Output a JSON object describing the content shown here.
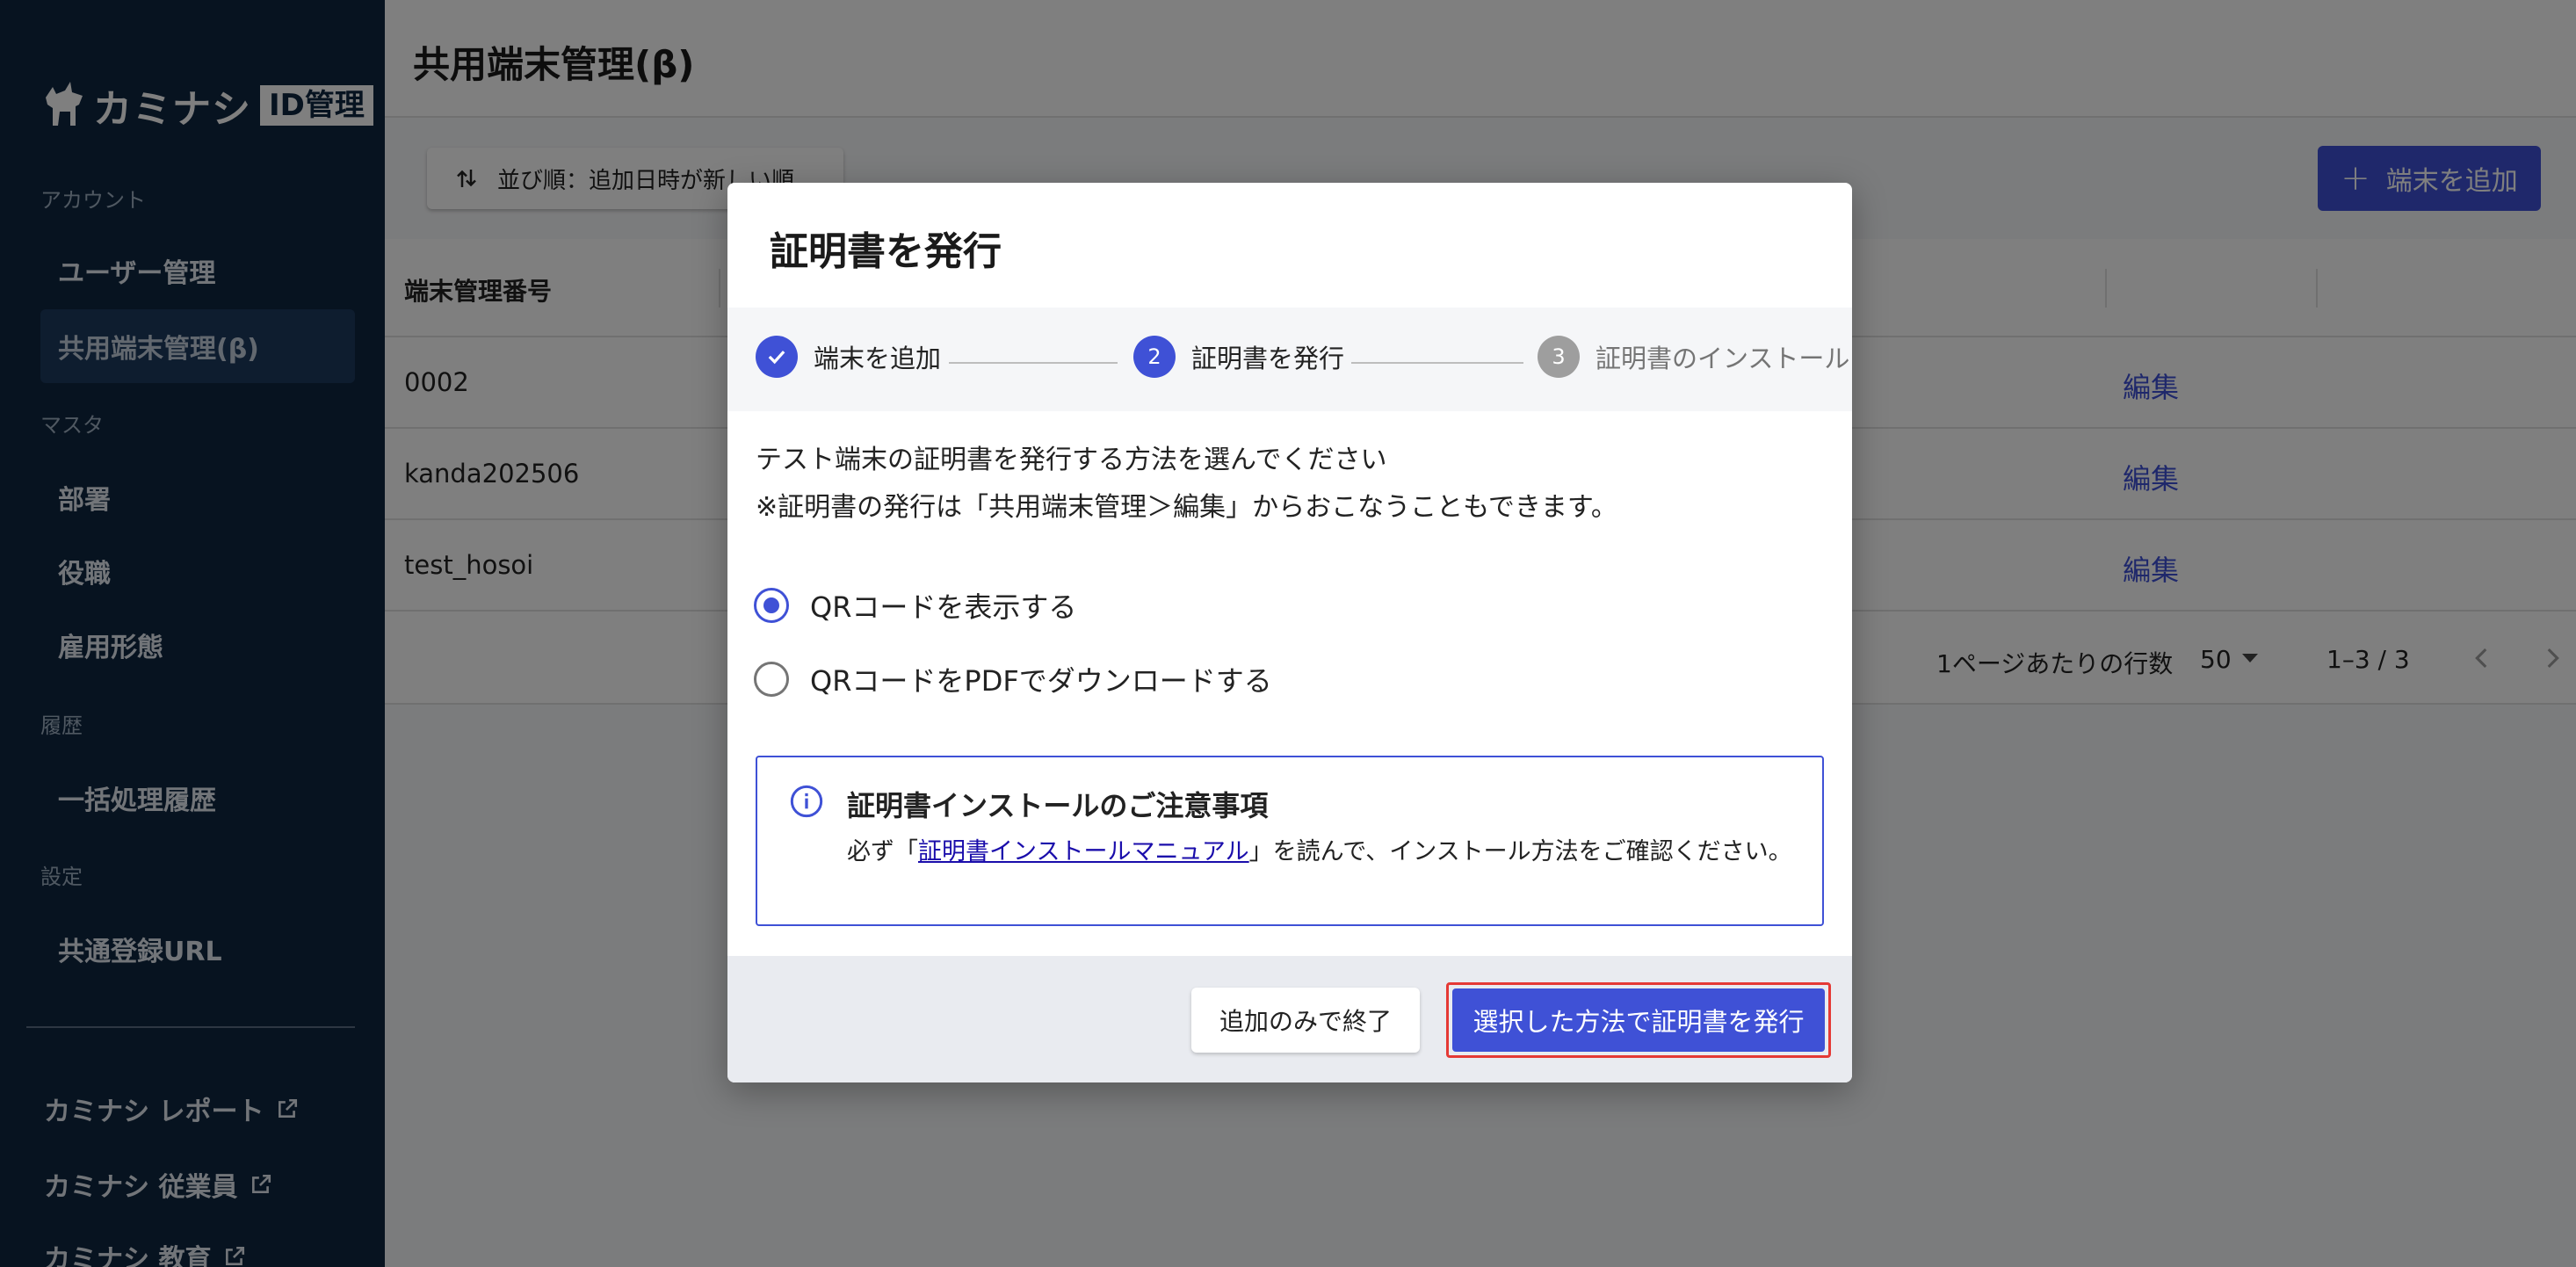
{
  "app": {
    "logo_text": "カミナシ",
    "logo_badge": "ID管理"
  },
  "sidebar": {
    "sections": [
      {
        "label": "アカウント"
      },
      {
        "label": "マスタ"
      },
      {
        "label": "履歴"
      },
      {
        "label": "設定"
      }
    ],
    "items": [
      {
        "label": "ユーザー管理"
      },
      {
        "label": "共用端末管理(β)"
      },
      {
        "label": "部署"
      },
      {
        "label": "役職"
      },
      {
        "label": "雇用形態"
      },
      {
        "label": "一括処理履歴"
      },
      {
        "label": "共通登録URL"
      }
    ],
    "external_links": [
      {
        "label": "カミナシ レポート"
      },
      {
        "label": "カミナシ 従業員"
      },
      {
        "label": "カミナシ 教育"
      }
    ]
  },
  "header": {
    "title": "共用端末管理(β)"
  },
  "toolbar": {
    "sort_label": "並び順：追加日時が新しい順",
    "add_label": "端末を追加"
  },
  "table": {
    "columns": [
      "端末管理番号"
    ],
    "rows": [
      {
        "id": "0002",
        "action": "編集"
      },
      {
        "id": "kanda202506",
        "action": "編集"
      },
      {
        "id": "test_hosoi",
        "action": "編集"
      }
    ]
  },
  "pagination": {
    "rows_per_page_label": "1ページあたりの行数",
    "rows_per_page": "50",
    "range": "1–3 / 3"
  },
  "modal": {
    "title": "証明書を発行",
    "steps": [
      {
        "number": "1",
        "label": "端末を追加",
        "state": "done"
      },
      {
        "number": "2",
        "label": "証明書を発行",
        "state": "current"
      },
      {
        "number": "3",
        "label": "証明書のインストール",
        "state": "todo"
      }
    ],
    "description_line1": "テスト端末の証明書を発行する方法を選んでください",
    "description_line2": "※証明書の発行は「共用端末管理＞編集」からおこなうこともできます。",
    "options": [
      {
        "label": "QRコードを表示する",
        "checked": true
      },
      {
        "label": "QRコードをPDFでダウンロードする",
        "checked": false
      }
    ],
    "notice": {
      "title": "証明書インストールのご注意事項",
      "body_before": "必ず「",
      "link": "証明書インストールマニュアル",
      "body_after": "」を読んで、インストール方法をご確認ください。"
    },
    "footer": {
      "secondary_label": "追加のみで終了",
      "primary_label": "選択した方法で証明書を発行"
    }
  },
  "colors": {
    "sidebar_bg": "#0f2640",
    "accent": "#3f51d6",
    "highlight_border": "#e53935"
  }
}
